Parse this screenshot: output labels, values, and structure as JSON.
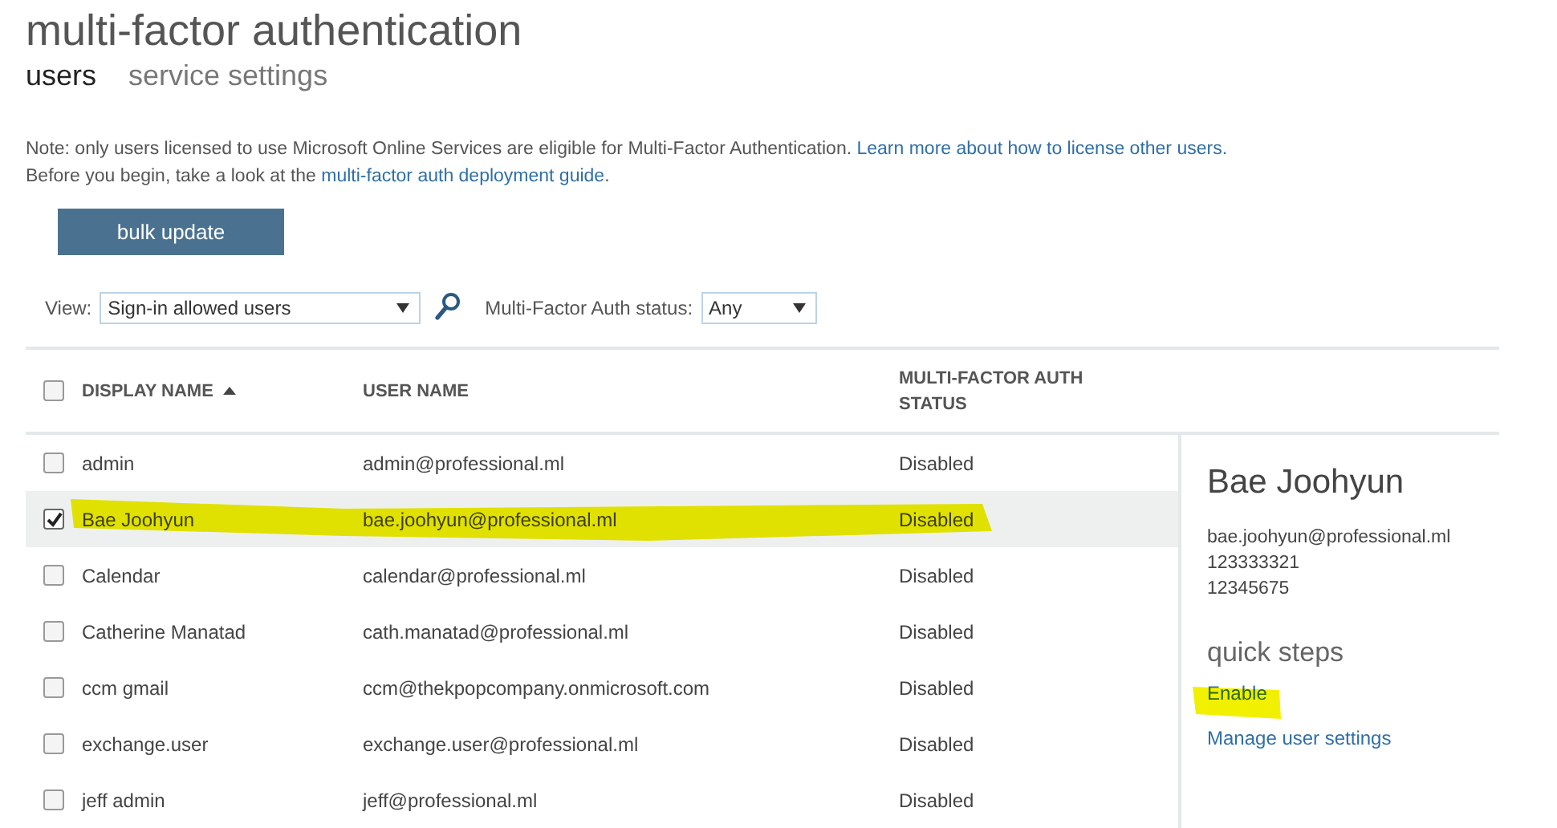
{
  "title": "multi-factor authentication",
  "tabs": [
    {
      "label": "users",
      "selected": true
    },
    {
      "label": "service settings",
      "selected": false
    }
  ],
  "note": {
    "line1": "Note: only users licensed to use Microsoft Online Services are eligible for Multi-Factor Authentication.",
    "line1_link": "Learn more about how to license other users.",
    "line2": "Before you begin, take a look at the",
    "line2_link": "multi-factor auth deployment guide",
    "line2_end": "."
  },
  "bulk_button": "bulk update",
  "filters": {
    "view_label": "View:",
    "view_value": "Sign-in allowed users",
    "status_label": "Multi-Factor Auth status:",
    "status_value": "Any"
  },
  "table": {
    "select_all_checked": false,
    "columns": [
      {
        "label": "DISPLAY NAME",
        "sorted": true
      },
      {
        "label": "USER NAME",
        "sorted": false
      },
      {
        "label": "MULTI-FACTOR AUTH STATUS",
        "sorted": false
      }
    ],
    "rows": [
      {
        "display_name": "admin",
        "user_name": "admin@professional.ml",
        "status": "Disabled",
        "selected": false
      },
      {
        "display_name": "Bae Joohyun",
        "user_name": "bae.joohyun@professional.ml",
        "status": "Disabled",
        "selected": true
      },
      {
        "display_name": "Calendar",
        "user_name": "calendar@professional.ml",
        "status": "Disabled",
        "selected": false
      },
      {
        "display_name": "Catherine Manatad",
        "user_name": "cath.manatad@professional.ml",
        "status": "Disabled",
        "selected": false
      },
      {
        "display_name": "ccm gmail",
        "user_name": "ccm@thekpopcompany.onmicrosoft.com",
        "status": "Disabled",
        "selected": false
      },
      {
        "display_name": "exchange.user",
        "user_name": "exchange.user@professional.ml",
        "status": "Disabled",
        "selected": false
      },
      {
        "display_name": "jeff admin",
        "user_name": "jeff@professional.ml",
        "status": "Disabled",
        "selected": false
      }
    ]
  },
  "details": {
    "name": "Bae Joohyun",
    "lines": [
      "bae.joohyun@professional.ml",
      "123333321",
      "12345675"
    ],
    "quick_steps_title": "quick steps",
    "links": [
      "Enable",
      "Manage user settings"
    ]
  }
}
